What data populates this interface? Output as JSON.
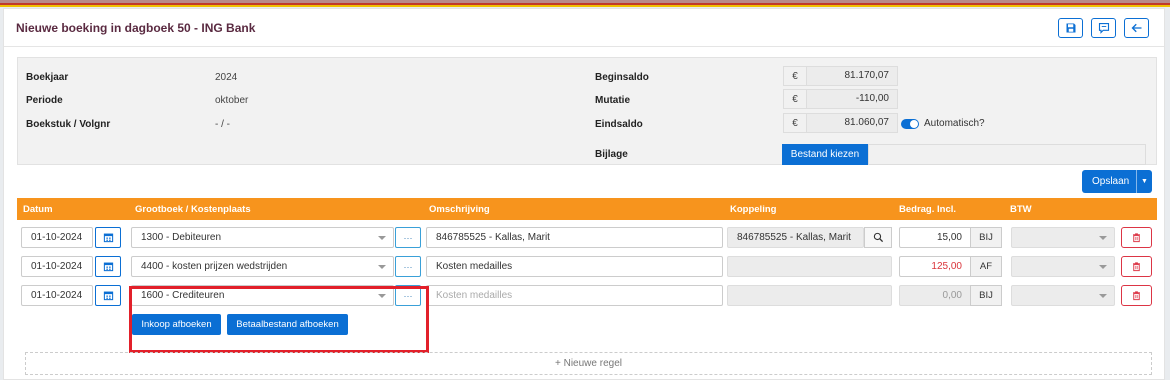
{
  "header": {
    "title": "Nieuwe boeking in dagboek 50 - ING Bank",
    "icons": [
      "save-icon",
      "comment-icon",
      "arrow-left-icon"
    ]
  },
  "info": {
    "boekjaar_label": "Boekjaar",
    "boekjaar_value": "2024",
    "periode_label": "Periode",
    "periode_value": "oktober",
    "boekstuk_label": "Boekstuk / Volgnr",
    "boekstuk_value": "- / -",
    "beginsaldo_label": "Beginsaldo",
    "beginsaldo_value": "81.170,07",
    "mutatie_label": "Mutatie",
    "mutatie_value": "-110,00",
    "eindsaldo_label": "Eindsaldo",
    "eindsaldo_value": "81.060,07",
    "currency": "€",
    "automatisch_label": "Automatisch?",
    "automatisch_on": true,
    "bijlage_label": "Bijlage",
    "bestand_button": "Bestand kiezen"
  },
  "toolbar": {
    "opslaan_label": "Opslaan"
  },
  "table": {
    "headers": {
      "datum": "Datum",
      "grootboek": "Grootboek / Kostenplaats",
      "omschrijving": "Omschrijving",
      "koppeling": "Koppeling",
      "bedrag": "Bedrag. Incl.",
      "btw": "BTW"
    },
    "rows": [
      {
        "datum": "01-10-2024",
        "grootboek": "1300 - Debiteuren",
        "omschrijving": "846785525 - Kallas, Marit",
        "koppeling": "846785525 - Kallas, Marit",
        "bedrag": "15,00",
        "type": "BIJ"
      },
      {
        "datum": "01-10-2024",
        "grootboek": "4400 - kosten prijzen wedstrijden",
        "omschrijving": "Kosten medailles",
        "koppeling": "",
        "bedrag": "125,00",
        "type": "AF"
      },
      {
        "datum": "01-10-2024",
        "grootboek": "1600 - Crediteuren",
        "omschrijving_placeholder": "Kosten medailles",
        "koppeling": "",
        "bedrag": "0,00",
        "type": "BIJ"
      }
    ],
    "dots": "···",
    "inkoop_button": "Inkoop afboeken",
    "betaalbestand_button": "Betaalbestand afboeken",
    "new_row_label": "+ Nieuwe regel"
  },
  "colors": {
    "accent": "#0b6fd4",
    "header_row": "#f7941d",
    "title": "#5a2a41",
    "danger": "#dc3545",
    "negative_amount": "#d9343a",
    "highlight": "#e2202a"
  }
}
